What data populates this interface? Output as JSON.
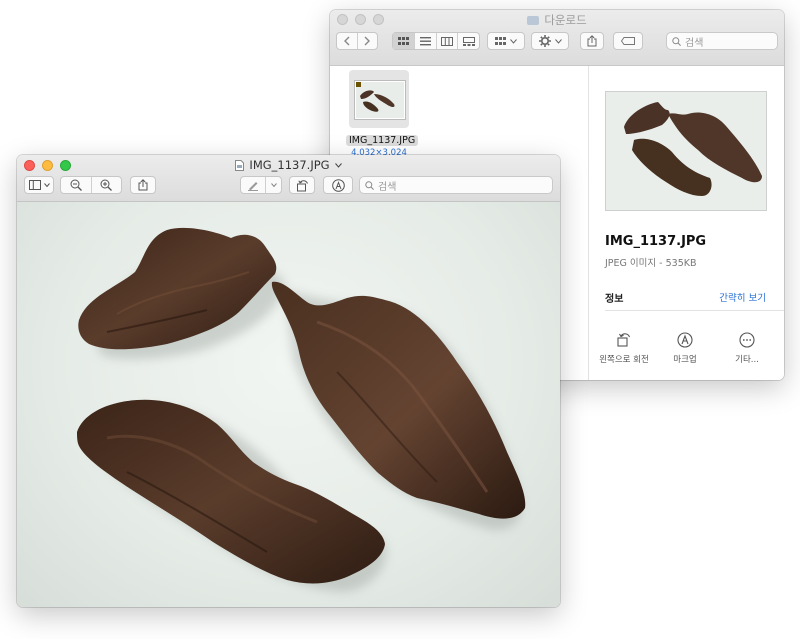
{
  "finder": {
    "title": "다운로드",
    "search_placeholder": "검색",
    "file": {
      "name": "IMG_1137.JPG",
      "dimensions": "4,032×3,024"
    },
    "preview_pane": {
      "name": "IMG_1137.JPG",
      "kind": "JPEG 이미지 - 535KB",
      "info_label": "정보",
      "show_less": "간략히 보기",
      "actions": [
        {
          "label": "왼쪽으로 회전",
          "icon": "rotate-left-icon"
        },
        {
          "label": "마크업",
          "icon": "markup-icon"
        },
        {
          "label": "기타...",
          "icon": "more-icon"
        }
      ]
    }
  },
  "preview": {
    "title": "IMG_1137.JPG",
    "search_placeholder": "검색",
    "image_subject": "Three carved dark wooden driftwood-like bowls on a pale background"
  },
  "colors": {
    "accent": "#2a6fd4",
    "close": "#fc605b",
    "minimize": "#fdbc40",
    "zoom": "#34c84a",
    "wood": "#4a3226"
  }
}
